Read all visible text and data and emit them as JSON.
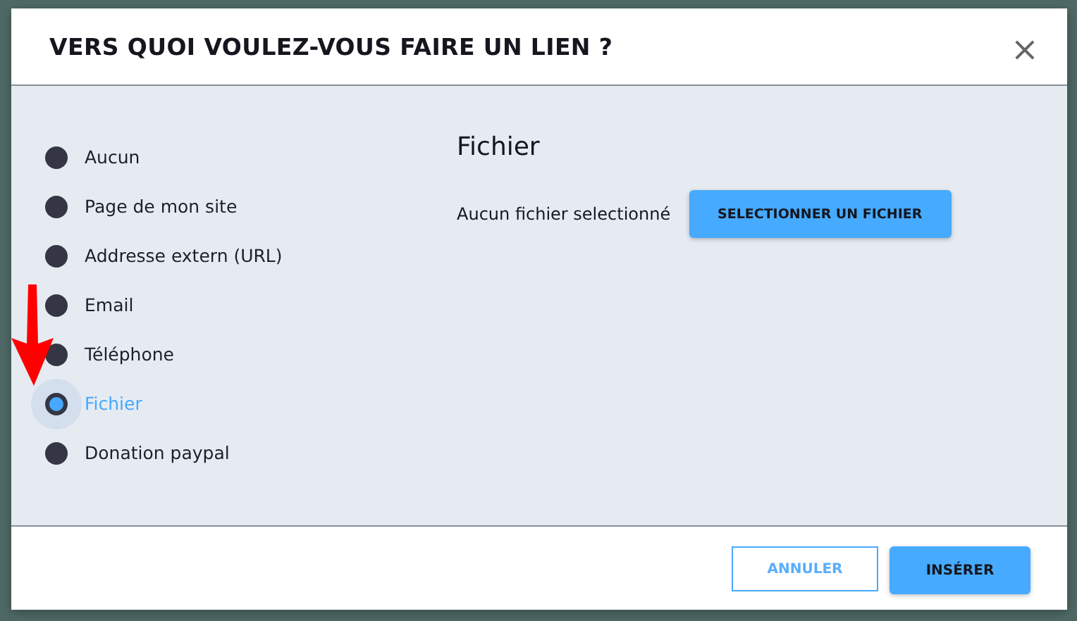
{
  "dialog": {
    "title": "VERS QUOI VOULEZ-VOUS FAIRE UN LIEN ?",
    "close": "×"
  },
  "options": [
    {
      "label": "Aucun",
      "selected": false
    },
    {
      "label": "Page de mon site",
      "selected": false
    },
    {
      "label": "Addresse extern (URL)",
      "selected": false
    },
    {
      "label": "Email",
      "selected": false
    },
    {
      "label": "Téléphone",
      "selected": false
    },
    {
      "label": "Fichier",
      "selected": true
    },
    {
      "label": "Donation paypal",
      "selected": false
    }
  ],
  "panel": {
    "heading": "Fichier",
    "status": "Aucun fichier selectionné",
    "button": "SELECTIONNER UN FICHIER"
  },
  "footer": {
    "cancel": "ANNULER",
    "insert": "INSÉRER"
  }
}
